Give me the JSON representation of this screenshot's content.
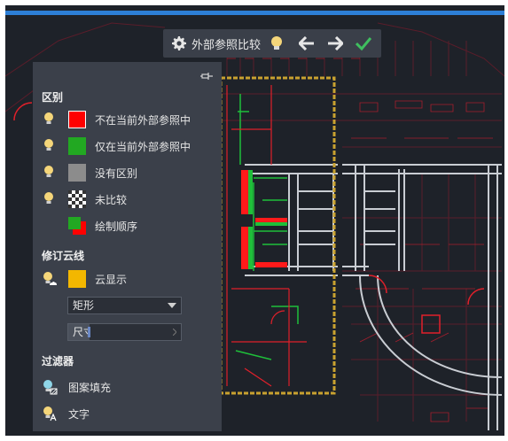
{
  "toolbar": {
    "title": "外部参照比较",
    "icons": [
      "gear-icon",
      "lightbulb-icon",
      "arrow-left-icon",
      "arrow-right-icon",
      "checkmark-icon"
    ]
  },
  "panel": {
    "pin_icon": "pin-icon",
    "differences": {
      "title": "区别",
      "items": [
        {
          "label": "不在当前外部参照中",
          "color": "#ff0000"
        },
        {
          "label": "仅在当前外部参照中",
          "color": "#22a822"
        },
        {
          "label": "没有区别",
          "color": "#8c8c8c"
        },
        {
          "label": "未比较",
          "swatch": "checkered"
        },
        {
          "label": "绘制顺序",
          "swatch": "green-red-overlap"
        }
      ]
    },
    "revision_cloud": {
      "title": "修订云线",
      "show_label": "云显示",
      "color": "#f3b700",
      "shape_value": "矩形",
      "size_value": "尺寸"
    },
    "filter": {
      "title": "过滤器",
      "items": [
        {
          "label": "图案填充"
        },
        {
          "label": "文字"
        }
      ]
    }
  },
  "colors": {
    "accent_blue": "#2d7fd6",
    "diff_red": "#ff0000",
    "diff_green": "#22a822",
    "cloud_yellow": "#f3b700",
    "check_green": "#3fbf5f"
  }
}
